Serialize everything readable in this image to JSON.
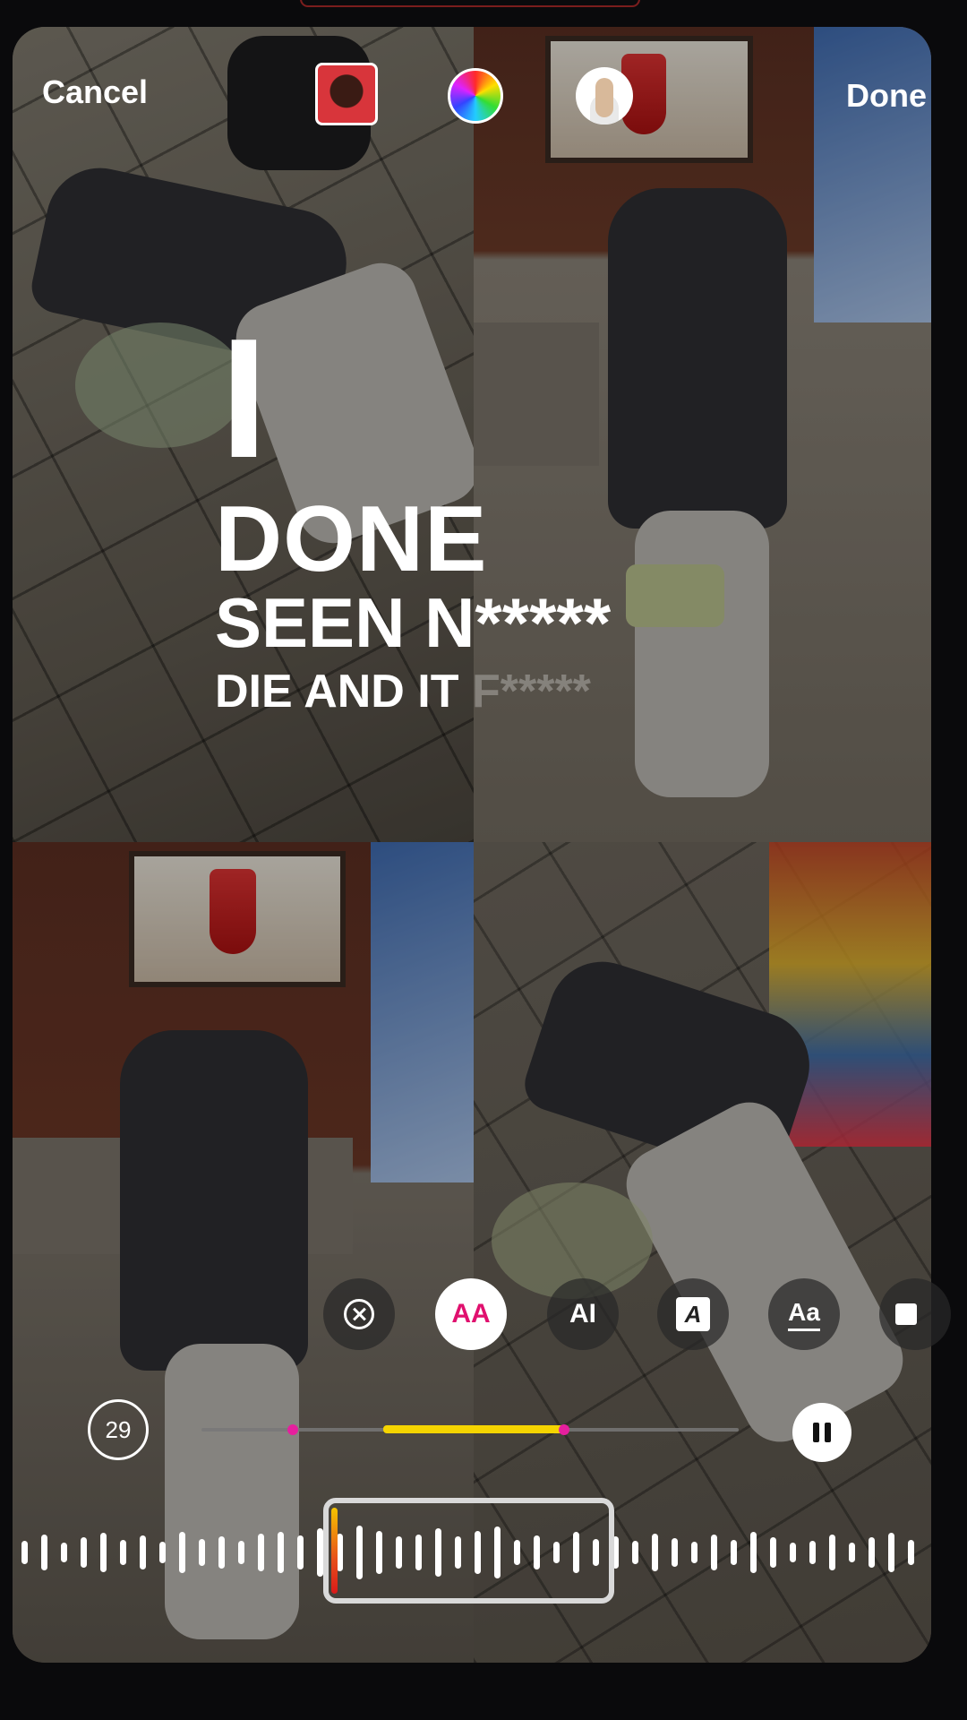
{
  "top_bar": {
    "cancel_label": "Cancel",
    "done_label": "Done",
    "thumbnail_icon": "song-cover-thumbnail",
    "color_icon": "color-wheel-icon",
    "avatar_icon": "profile-avatar"
  },
  "lyrics": {
    "line1": "I",
    "line2": "DONE",
    "line3_main": "SEEN N",
    "line3_rest": "*****",
    "line4_main": "DIE AND IT ",
    "line4_rest": "F*****"
  },
  "tools": {
    "close_icon": "close-circle-icon",
    "style_active_label": "AA",
    "style_ai_label": "AI",
    "style_italic_label": "A",
    "style_aa_label": "Aa",
    "extra_icon": "square-icon"
  },
  "playback": {
    "timer_value": "29",
    "pause_icon": "pause-icon"
  },
  "colors": {
    "accent_pink": "#e0106e",
    "progress_yellow": "#f5d400",
    "marker_magenta": "#e61f9e"
  }
}
